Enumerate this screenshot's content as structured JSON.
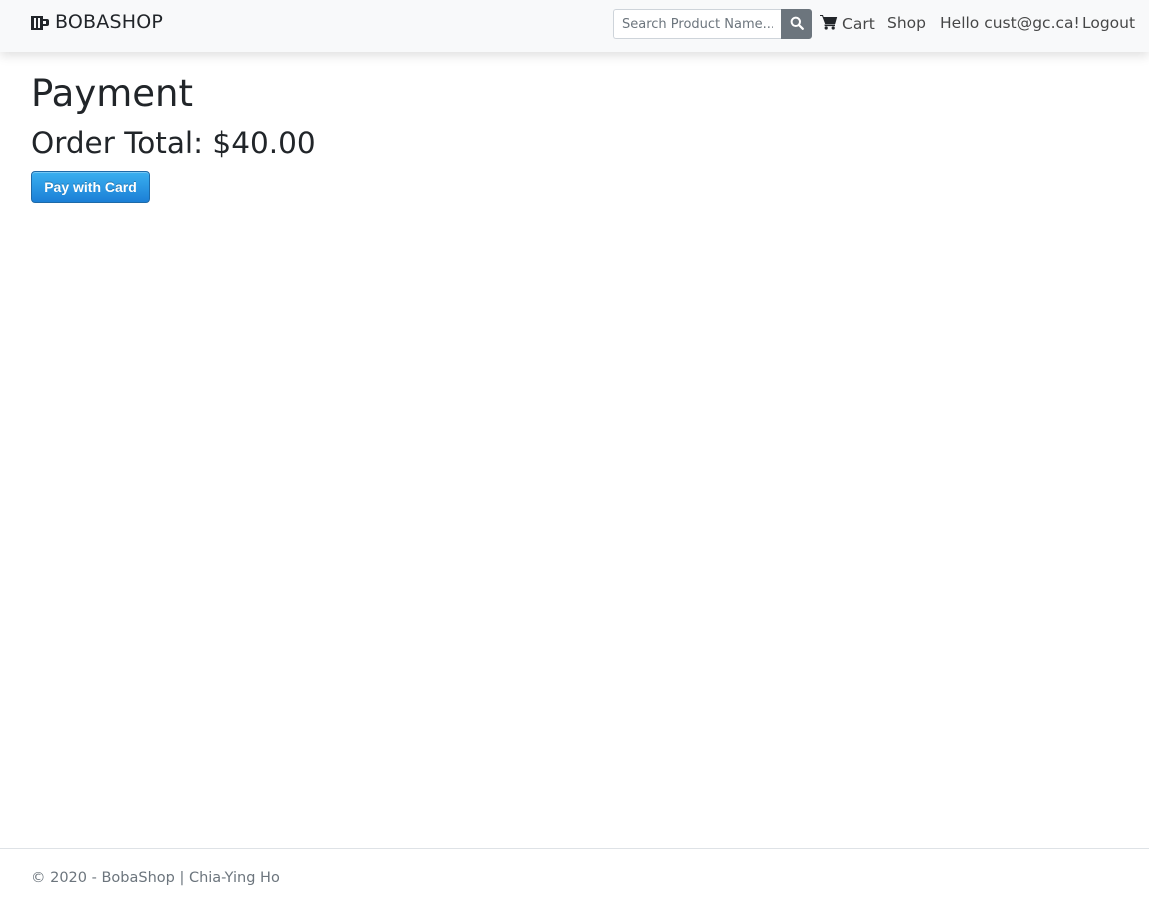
{
  "navbar": {
    "brand": "BOBASHOP",
    "brand_icon": "boba-cup-icon",
    "search": {
      "placeholder": "Search Product Name..."
    },
    "links": {
      "cart": "Cart",
      "shop": "Shop",
      "greeting": "Hello cust@gc.ca!",
      "logout": "Logout"
    }
  },
  "main": {
    "title": "Payment",
    "order_total": "Order Total: $40.00",
    "pay_button": "Pay with Card"
  },
  "footer": {
    "text": "© 2020 - BobaShop | Chia-Ying Ho"
  },
  "colors": {
    "navbar_bg": "#f8f9fa",
    "search_button": "#6c757d",
    "pay_button": "#1c7fd6",
    "text": "#212529",
    "footer_text": "#6c757d"
  }
}
